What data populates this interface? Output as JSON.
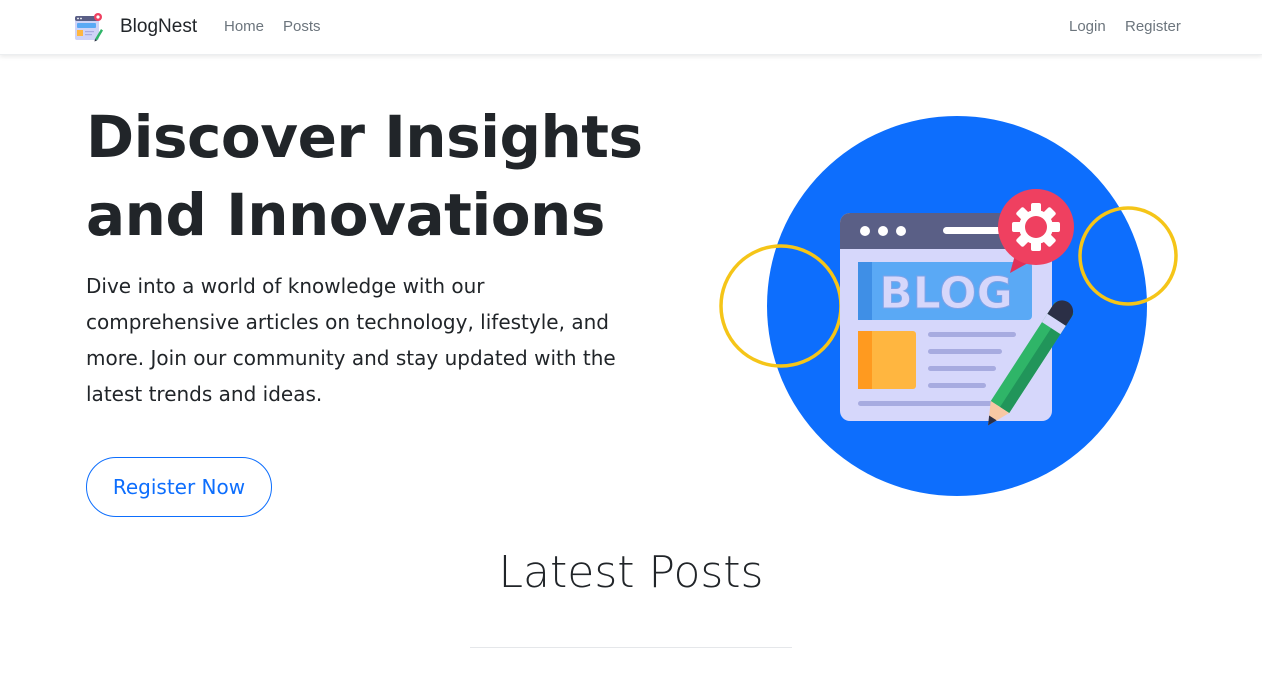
{
  "navbar": {
    "brand_name": "BlogNest",
    "brand_logo_icon": "blog-window-icon",
    "links_left": [
      "Home",
      "Posts"
    ],
    "links_right": [
      "Login",
      "Register"
    ]
  },
  "hero": {
    "title": "Discover Insights and Innovations",
    "lead": "Dive into a world of knowledge with our comprehensive articles on technology, lifestyle, and more. Join our community and stay updated with the latest trends and ideas.",
    "cta_label": "Register Now",
    "illustration": {
      "icon": "blog-illustration",
      "banner_text": "BLOG"
    }
  },
  "latest_posts": {
    "title": "Latest Posts"
  },
  "colors": {
    "primary": "#0d6efd",
    "accent_ring": "#f5c518",
    "gear": "#ef4060",
    "text": "#212529",
    "nav_text": "#6c757d"
  }
}
